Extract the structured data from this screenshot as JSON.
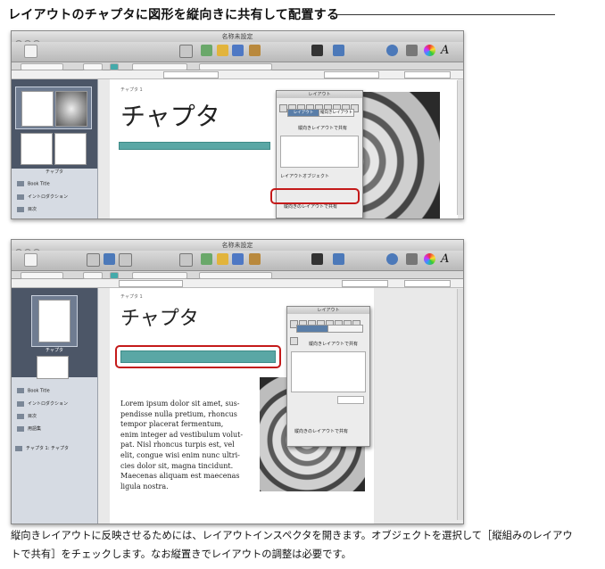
{
  "heading": "レイアウトのチャプタに図形を縦向きに共有して配置する",
  "caption": "縦向きレイアウトに反映させるためには、レイアウトインスペクタを開きます。オブジェクトを選択して［縦組みのレイアウトで共有］をチェックします。なお縦置きでレイアウトの調整は必要です。",
  "screenshot1": {
    "window_title": "名称未設定",
    "sidebar_caption": "チャプタ",
    "sidebar_items": [
      "Book Title",
      "イントロダクション",
      "目次"
    ],
    "chapter_small": "チャプタ 1",
    "chapter_title": "チャプタ",
    "inspector": {
      "title": "レイアウト",
      "seg_left": "レイアウト",
      "seg_right": "縦向きレイアウト",
      "check1": "縦向きレイアウトで共有",
      "section": "レイアウトオブジェクト",
      "share_label": "縦向きのレイアウトで共有"
    }
  },
  "screenshot2": {
    "window_title": "名称未設定",
    "sidebar_caption": "チャプタ",
    "sidebar_items": [
      "Book Title",
      "イントロダクション",
      "目次",
      "用語集"
    ],
    "sidebar_item_chapter": "チャプタ 1: チャプタ",
    "chapter_small": "チャプタ 1",
    "chapter_title": "チャプタ",
    "lorem": "Lorem ipsum dolor sit amet, sus-\npendisse nulla pretium, rhoncus\ntempor placerat fermentum,\nenim integer ad vestibulum volut-\npat. Nisl rhoncus turpis est, vel\nelit, congue wisi enim nunc ultri-\ncies dolor sit, magna tincidunt.\nMaecenas aliquam est maecenas\nligula nostra.",
    "inspector": {
      "title": "レイアウト",
      "check1": "縦向きレイアウトで共有",
      "share_label": "縦向きのレイアウトで共有"
    }
  }
}
